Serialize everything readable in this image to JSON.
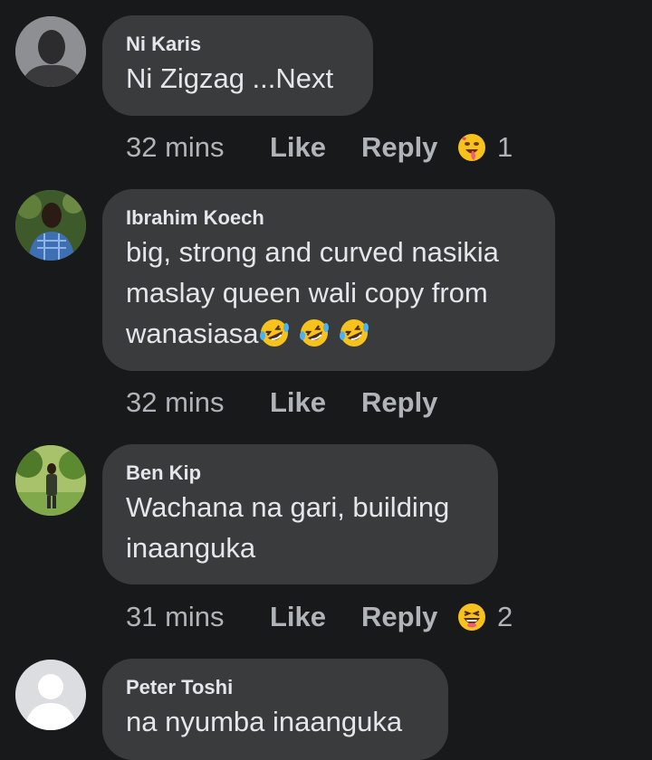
{
  "comments": [
    {
      "author": "Ni Karis",
      "text": "Ni Zigzag ...Next",
      "time": "32 mins",
      "like_label": "Like",
      "reply_label": "Reply",
      "reaction": {
        "icon": "drooling-face-icon",
        "count": "1"
      }
    },
    {
      "author": "Ibrahim Koech",
      "text": "big, strong and curved nasikia\nmaslay queen wali copy from\nwanasiasa",
      "text_emojis": [
        "rolling-on-floor-laughing-icon",
        "rolling-on-floor-laughing-icon",
        "rolling-on-floor-laughing-icon"
      ],
      "time": "32 mins",
      "like_label": "Like",
      "reply_label": "Reply"
    },
    {
      "author": "Ben Kip",
      "text": "Wachana na gari, building\ninaanguka",
      "time": "31 mins",
      "like_label": "Like",
      "reply_label": "Reply",
      "reaction": {
        "icon": "laughing-face-icon",
        "count": "2"
      }
    },
    {
      "author": "Peter Toshi",
      "text": "na nyumba inaanguka"
    }
  ],
  "colors": {
    "background": "#18191a",
    "bubble": "#3a3b3c",
    "primary_text": "#e4e6eb",
    "secondary_text": "#b0b3b8"
  }
}
